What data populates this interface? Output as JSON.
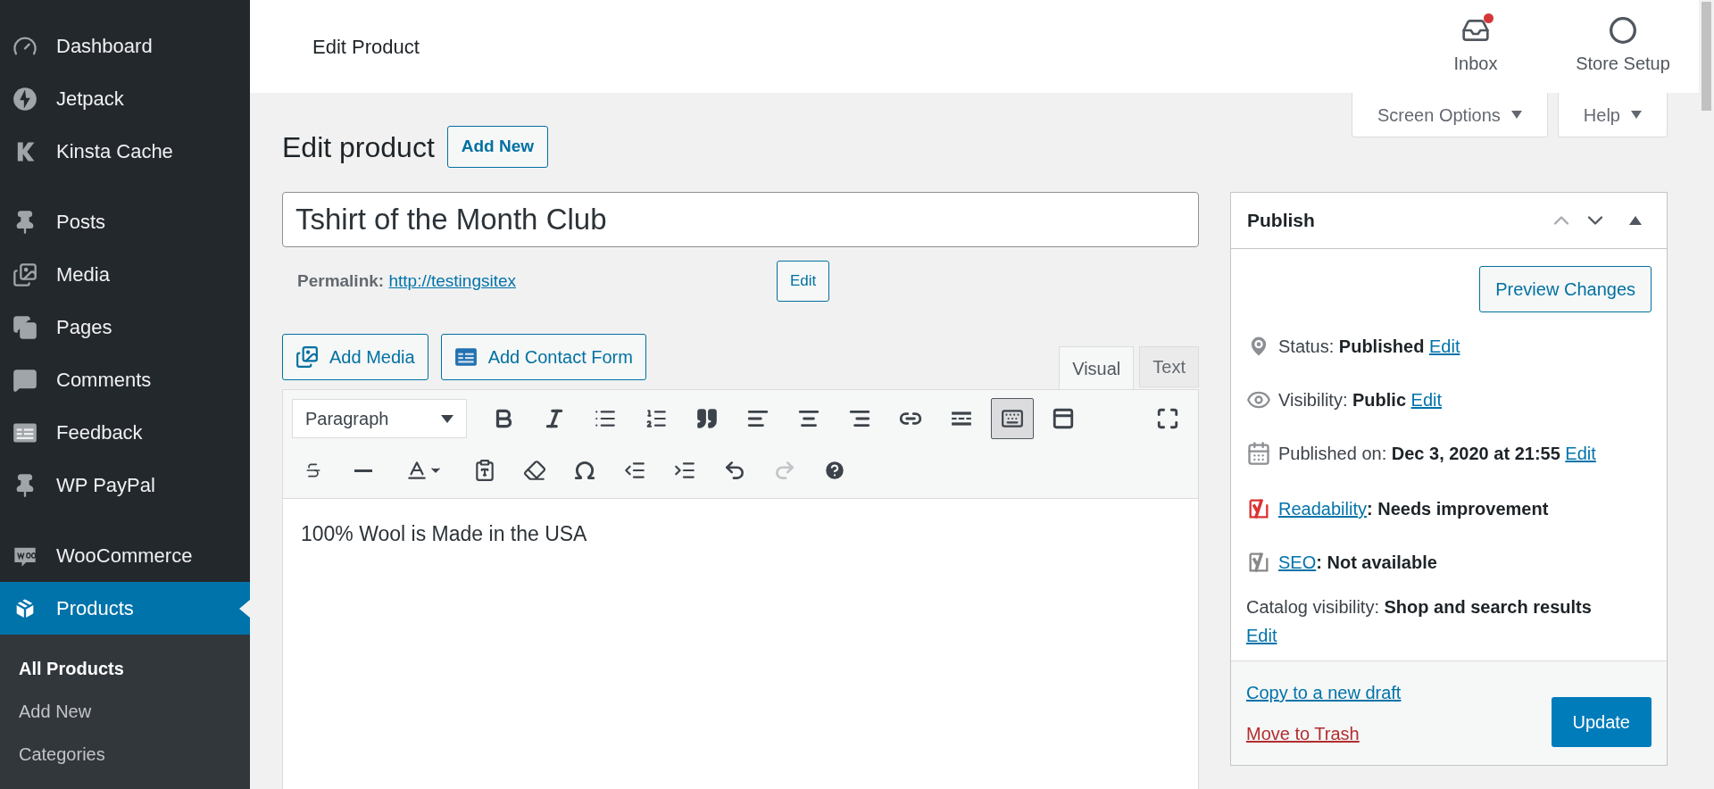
{
  "sidebar": {
    "groups": [
      {
        "items": [
          {
            "label": "Dashboard",
            "selected": false
          },
          {
            "label": "Jetpack",
            "selected": false
          },
          {
            "label": "Kinsta Cache",
            "selected": false
          }
        ]
      },
      {
        "items": [
          {
            "label": "Posts",
            "selected": false
          },
          {
            "label": "Media",
            "selected": false
          },
          {
            "label": "Pages",
            "selected": false
          },
          {
            "label": "Comments",
            "selected": false
          },
          {
            "label": "Feedback",
            "selected": false
          },
          {
            "label": "WP PayPal",
            "selected": false
          }
        ]
      },
      {
        "items": [
          {
            "label": "WooCommerce",
            "selected": false
          },
          {
            "label": "Products",
            "selected": true
          }
        ]
      }
    ],
    "submenu": [
      {
        "label": "All Products",
        "selected": true
      },
      {
        "label": "Add New",
        "selected": false
      },
      {
        "label": "Categories",
        "selected": false
      }
    ]
  },
  "top_bar": {
    "title": "Edit Product",
    "actions": [
      {
        "label": "Inbox",
        "unread": true
      },
      {
        "label": "Store Setup",
        "unread": false
      }
    ]
  },
  "screen_tabs": [
    "Screen Options",
    "Help"
  ],
  "heading": {
    "title": "Edit product",
    "button": "Add New"
  },
  "title_field": {
    "value": "Tshirt of the Month Club"
  },
  "permalink": {
    "label": "Permalink:",
    "link": "http://testingsitex",
    "button": "Edit"
  },
  "media_buttons": [
    "Add Media",
    "Add Contact Form"
  ],
  "editor_tabs": [
    {
      "label": "Visual",
      "selected": true
    },
    {
      "label": "Text",
      "selected": false
    }
  ],
  "toolbar": {
    "format": "Paragraph",
    "row_1": [
      {
        "pressed": false
      },
      {
        "pressed": false
      },
      {
        "pressed": false
      },
      {
        "pressed": false
      },
      {
        "pressed": false
      },
      {
        "pressed": false
      },
      {
        "pressed": false
      },
      {
        "pressed": false
      },
      {
        "pressed": false
      },
      {
        "pressed": false
      },
      {
        "pressed": true
      },
      {
        "pressed": false
      },
      {
        "pressed": false
      }
    ],
    "row_2": [
      {
        "disabled": false
      },
      {
        "disabled": false
      },
      {
        "disabled": false
      },
      {
        "disabled": false
      },
      {
        "disabled": false
      },
      {
        "disabled": false
      },
      {
        "disabled": false
      },
      {
        "disabled": false
      },
      {
        "disabled": false
      },
      {
        "disabled": true
      },
      {
        "disabled": false
      }
    ]
  },
  "content": "100% Wool is Made in the USA",
  "publish": {
    "title": "Publish",
    "preview_button": "Preview Changes",
    "rows": [
      {
        "kind": "status",
        "label": "Status:",
        "value": "Published",
        "link": "Edit"
      },
      {
        "kind": "visibility",
        "label": "Visibility:",
        "value": "Public",
        "link": "Edit"
      },
      {
        "kind": "date",
        "label": "Published on:",
        "value": "Dec 3, 2020 at 21:55",
        "link": "Edit"
      },
      {
        "kind": "score",
        "link": "Readability",
        "separator": ":",
        "value": "Needs improvement",
        "color": "#dc3232"
      },
      {
        "kind": "score",
        "link": "SEO",
        "separator": ":",
        "value": "Not available",
        "color": "#888888"
      },
      {
        "kind": "catalog",
        "label": "Catalog visibility:",
        "value": "Shop and search results",
        "link": "Edit"
      }
    ],
    "copy_link": "Copy to a new draft",
    "trash_link": "Move to Trash",
    "update_button": "Update"
  }
}
